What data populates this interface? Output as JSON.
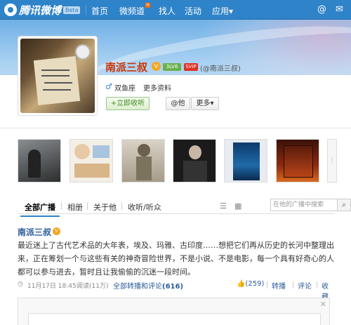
{
  "nav": {
    "logo_text": "腾讯微博",
    "beta": "Beta",
    "items": [
      "首页",
      "微频道",
      "找人",
      "活动",
      "应用"
    ],
    "apps_arrow": "▾",
    "at_icon": "@",
    "mail_icon": "✉"
  },
  "profile": {
    "name": "南派三叔",
    "level": "3LV6",
    "vip": "SVIP",
    "handle": "(@南派三叔)",
    "sign": "双鱼座",
    "more_info": "更多资料",
    "listen_btn": "+立即收听",
    "at_btn": "@他",
    "more_btn": "更多▾"
  },
  "tabs": {
    "items": [
      "全部广播",
      "相册",
      "关于他",
      "收听/听众"
    ],
    "search_placeholder": "在他的广播中搜索"
  },
  "post": {
    "author": "南派三叔",
    "text": "最近迷上了古代艺术品的大年表，埃及、玛雅、古印度……想把它们再从历史的长河中整理出来，正在筹划一个与这些有关的神奇冒险世界，不是小说、不是电影，每一个具有好奇心的人都可以参与进去，暂时且让我偷偷的沉迷一段时间。",
    "date": "11月17日 18:45",
    "reads": "阅读(11万)",
    "all_label": "全部转播和评论",
    "all_count": "(616)",
    "likes": "(259)",
    "repost": "转播",
    "comment": "评论",
    "favorite": "收藏"
  },
  "colors": {
    "brand": "#2f83c8",
    "name_red": "#c30",
    "link": "#2a5b9a"
  }
}
